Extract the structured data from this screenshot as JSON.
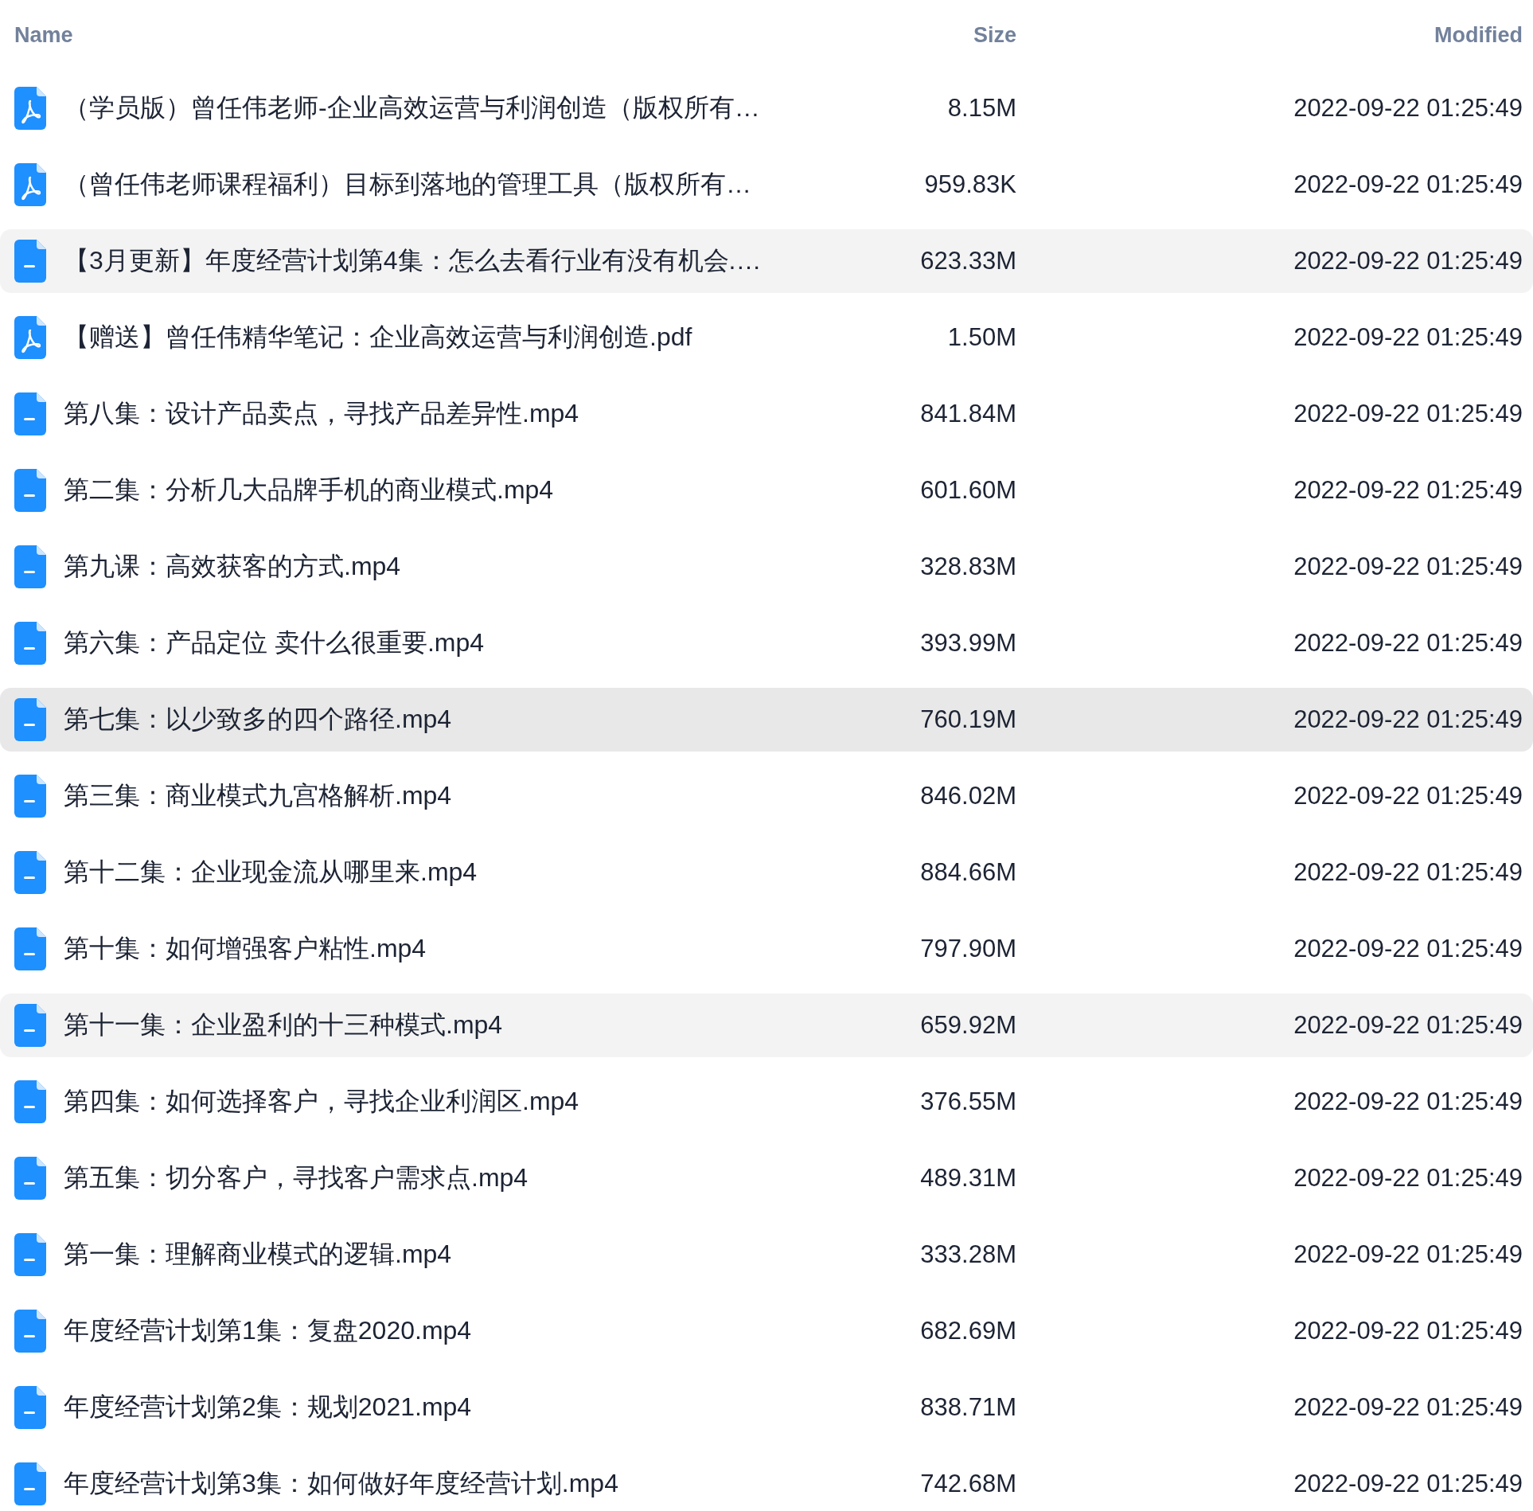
{
  "columns": [
    {
      "label": "Name"
    },
    {
      "label": "Size"
    },
    {
      "label": "Modified"
    }
  ],
  "rows": [
    {
      "kind": "pdf",
      "name": "（学员版）曾任伟老师-企业高效运营与利润创造（版权所有…",
      "size": "8.15M",
      "modified": "2022-09-22 01:25:49",
      "selected": false,
      "hovered": false
    },
    {
      "kind": "pdf",
      "name": "（曾任伟老师课程福利）目标到落地的管理工具（版权所有…",
      "size": "959.83K",
      "modified": "2022-09-22 01:25:49",
      "selected": false,
      "hovered": false
    },
    {
      "kind": "file",
      "name": "【3月更新】年度经营计划第4集：怎么去看行业有没有机会.…",
      "size": "623.33M",
      "modified": "2022-09-22 01:25:49",
      "selected": false,
      "hovered": true
    },
    {
      "kind": "pdf",
      "name": "【赠送】曾任伟精华笔记：企业高效运营与利润创造.pdf",
      "size": "1.50M",
      "modified": "2022-09-22 01:25:49",
      "selected": false,
      "hovered": false
    },
    {
      "kind": "file",
      "name": "第八集：设计产品卖点，寻找产品差异性.mp4",
      "size": "841.84M",
      "modified": "2022-09-22 01:25:49",
      "selected": false,
      "hovered": false
    },
    {
      "kind": "file",
      "name": "第二集：分析几大品牌手机的商业模式.mp4",
      "size": "601.60M",
      "modified": "2022-09-22 01:25:49",
      "selected": false,
      "hovered": false
    },
    {
      "kind": "file",
      "name": "第九课：高效获客的方式.mp4",
      "size": "328.83M",
      "modified": "2022-09-22 01:25:49",
      "selected": false,
      "hovered": false
    },
    {
      "kind": "file",
      "name": "第六集：产品定位 卖什么很重要.mp4",
      "size": "393.99M",
      "modified": "2022-09-22 01:25:49",
      "selected": false,
      "hovered": false
    },
    {
      "kind": "file",
      "name": "第七集：以少致多的四个路径.mp4",
      "size": "760.19M",
      "modified": "2022-09-22 01:25:49",
      "selected": true,
      "hovered": false
    },
    {
      "kind": "file",
      "name": "第三集：商业模式九宫格解析.mp4",
      "size": "846.02M",
      "modified": "2022-09-22 01:25:49",
      "selected": false,
      "hovered": false
    },
    {
      "kind": "file",
      "name": "第十二集：企业现金流从哪里来.mp4",
      "size": "884.66M",
      "modified": "2022-09-22 01:25:49",
      "selected": false,
      "hovered": false
    },
    {
      "kind": "file",
      "name": "第十集：如何增强客户粘性.mp4",
      "size": "797.90M",
      "modified": "2022-09-22 01:25:49",
      "selected": false,
      "hovered": false
    },
    {
      "kind": "file",
      "name": "第十一集：企业盈利的十三种模式.mp4",
      "size": "659.92M",
      "modified": "2022-09-22 01:25:49",
      "selected": false,
      "hovered": true
    },
    {
      "kind": "file",
      "name": "第四集：如何选择客户，寻找企业利润区.mp4",
      "size": "376.55M",
      "modified": "2022-09-22 01:25:49",
      "selected": false,
      "hovered": false
    },
    {
      "kind": "file",
      "name": "第五集：切分客户，寻找客户需求点.mp4",
      "size": "489.31M",
      "modified": "2022-09-22 01:25:49",
      "selected": false,
      "hovered": false
    },
    {
      "kind": "file",
      "name": "第一集：理解商业模式的逻辑.mp4",
      "size": "333.28M",
      "modified": "2022-09-22 01:25:49",
      "selected": false,
      "hovered": false
    },
    {
      "kind": "file",
      "name": "年度经营计划第1集：复盘2020.mp4",
      "size": "682.69M",
      "modified": "2022-09-22 01:25:49",
      "selected": false,
      "hovered": false
    },
    {
      "kind": "file",
      "name": "年度经营计划第2集：规划2021.mp4",
      "size": "838.71M",
      "modified": "2022-09-22 01:25:49",
      "selected": false,
      "hovered": false
    },
    {
      "kind": "file",
      "name": "年度经营计划第3集：如何做好年度经营计划.mp4",
      "size": "742.68M",
      "modified": "2022-09-22 01:25:49",
      "selected": false,
      "hovered": false
    }
  ]
}
